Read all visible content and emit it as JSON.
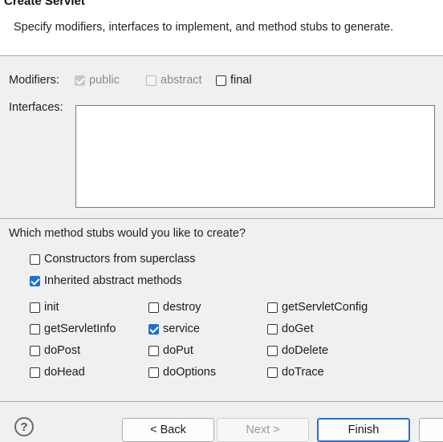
{
  "banner": {
    "title": "Create Servlet",
    "description": "Specify modifiers, interfaces to implement, and method stubs to generate."
  },
  "modifiers": {
    "label": "Modifiers:",
    "public": {
      "label": "public",
      "checked": true,
      "enabled": false
    },
    "abstract": {
      "label": "abstract",
      "checked": false,
      "enabled": false
    },
    "final": {
      "label": "final",
      "checked": false,
      "enabled": true
    }
  },
  "interfaces": {
    "label": "Interfaces:",
    "items": []
  },
  "stubs": {
    "question": "Which method stubs would you like to create?",
    "constructors": {
      "label": "Constructors from superclass",
      "checked": false
    },
    "inherited": {
      "label": "Inherited abstract methods",
      "checked": true
    },
    "methods": [
      {
        "label": "init",
        "checked": false
      },
      {
        "label": "destroy",
        "checked": false
      },
      {
        "label": "getServletConfig",
        "checked": false
      },
      {
        "label": "getServletInfo",
        "checked": false
      },
      {
        "label": "service",
        "checked": true
      },
      {
        "label": "doGet",
        "checked": false
      },
      {
        "label": "doPost",
        "checked": false
      },
      {
        "label": "doPut",
        "checked": false
      },
      {
        "label": "doDelete",
        "checked": false
      },
      {
        "label": "doHead",
        "checked": false
      },
      {
        "label": "doOptions",
        "checked": false
      },
      {
        "label": "doTrace",
        "checked": false
      }
    ]
  },
  "buttons": {
    "help_symbol": "?",
    "back": "< Back",
    "next": "Next >",
    "finish": "Finish"
  },
  "icons": {
    "help": "help-icon",
    "check": "checkmark-icon"
  },
  "colors": {
    "accent": "#1e6fd0",
    "banner_bg": "#ffffff",
    "dialog_bg": "#f0f0f0"
  }
}
